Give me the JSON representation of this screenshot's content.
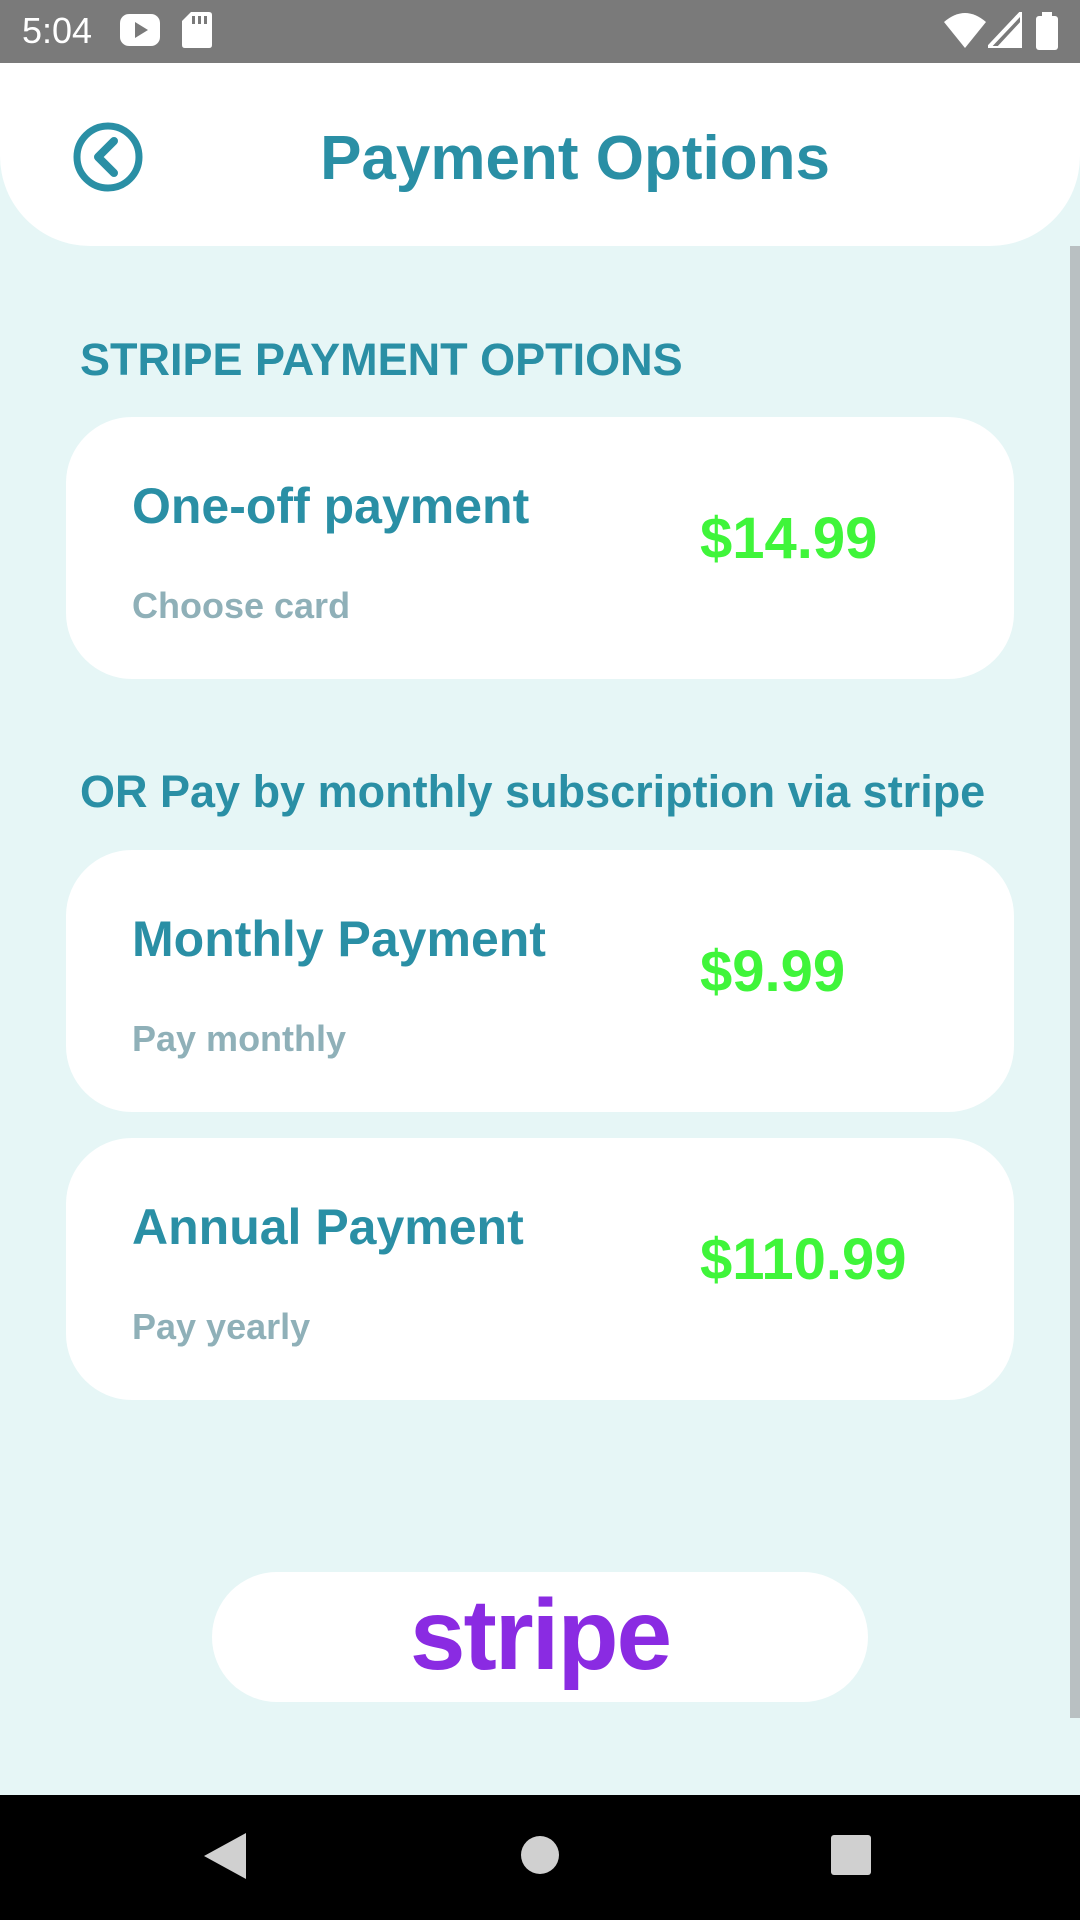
{
  "status_bar": {
    "time": "5:04",
    "icons": [
      "youtube-icon",
      "sd-card-icon",
      "wifi-icon",
      "signal-icon",
      "battery-icon"
    ]
  },
  "header": {
    "title": "Payment Options",
    "back_icon": "back-circle-icon"
  },
  "sections": {
    "stripe_heading": "STRIPE PAYMENT OPTIONS",
    "subscription_heading": "OR Pay by monthly subscription via stripe"
  },
  "cards": [
    {
      "title": "One-off payment",
      "subtitle": "Choose card",
      "price": "$14.99"
    },
    {
      "title": "Monthly Payment",
      "subtitle": "Pay monthly",
      "price": "$9.99"
    },
    {
      "title": "Annual Payment",
      "subtitle": "Pay yearly",
      "price": "$110.99"
    }
  ],
  "stripe_button": {
    "logo_text": "stripe"
  },
  "colors": {
    "accent": "#2a8fa5",
    "price": "#3ff53a",
    "stripe": "#8a2be2",
    "background": "#e6f6f6",
    "subtitle": "#8fb0b8"
  },
  "nav_bar": {
    "icons": [
      "back-triangle-icon",
      "home-circle-icon",
      "recents-square-icon"
    ]
  }
}
